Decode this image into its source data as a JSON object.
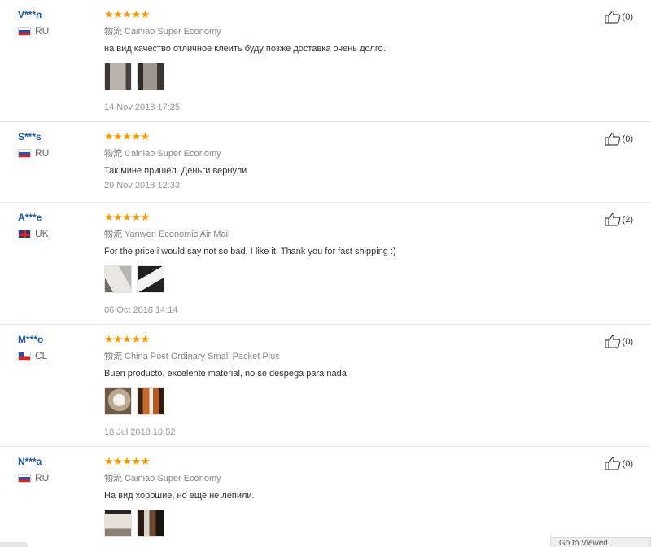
{
  "reviews": [
    {
      "user": "V***n",
      "country": "RU",
      "flag": "ru",
      "stars": "★★★★★",
      "ship_prefix": "物流",
      "ship": "Cainiao Super Economy",
      "text": "на вид качество отличное клеить буду позже доставка очень долго.",
      "date": "14 Nov 2018 17:25",
      "helpful": "(0)"
    },
    {
      "user": "S***s",
      "country": "RU",
      "flag": "ru",
      "stars": "★★★★★",
      "ship_prefix": "物流",
      "ship": "Cainiao Super Economy",
      "text": "Так мине пришёл. Деньги вернули",
      "date": "29 Nov 2018 12:33",
      "helpful": "(0)"
    },
    {
      "user": "A***e",
      "country": "UK",
      "flag": "uk",
      "stars": "★★★★★",
      "ship_prefix": "物流",
      "ship": "Yanwen Economic Air Mail",
      "text": "For the price i would say not so bad, I like it. Thank you for fast shipping :)",
      "date": "06 Oct 2018 14:14",
      "helpful": "(2)"
    },
    {
      "user": "M***o",
      "country": "CL",
      "flag": "cl",
      "stars": "★★★★★",
      "ship_prefix": "物流",
      "ship": "China Post Ordinary Small Packet Plus",
      "text": "Buen producto, excelente material, no se despega para nada",
      "date": "18 Jul 2018 10:52",
      "helpful": "(0)"
    },
    {
      "user": "N***a",
      "country": "RU",
      "flag": "ru",
      "stars": "★★★★★",
      "ship_prefix": "物流",
      "ship": "Cainiao Super Economy",
      "text": "На вид хорошие, но ещё не лепили.",
      "helpful": "(0)"
    }
  ],
  "footer_button": "Go to Viewed"
}
